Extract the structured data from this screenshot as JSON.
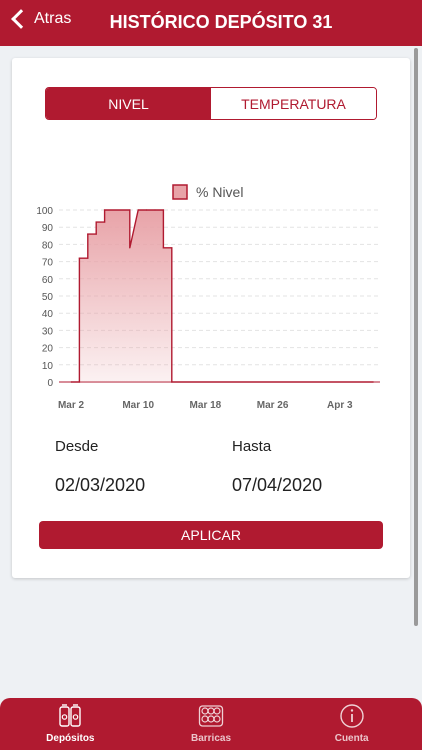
{
  "header": {
    "back_label": "Atras",
    "title": "HISTÓRICO DEPÓSITO 31"
  },
  "segmented": {
    "tabs": [
      {
        "label": "NIVEL",
        "active": true
      },
      {
        "label": "TEMPERATURA",
        "active": false
      }
    ]
  },
  "chart_data": {
    "type": "area",
    "legend": "% Nivel",
    "ylim": [
      0,
      100
    ],
    "yticks": [
      "0",
      "10",
      "20",
      "30",
      "40",
      "50",
      "60",
      "70",
      "80",
      "90",
      "100"
    ],
    "xticks": [
      "Mar 2",
      "Mar 10",
      "Mar 18",
      "Mar 26",
      "Apr 3"
    ],
    "series": [
      {
        "name": "% Nivel",
        "x": [
          "2020-03-02",
          "2020-03-03",
          "2020-03-03",
          "2020-03-04",
          "2020-03-04",
          "2020-03-05",
          "2020-03-05",
          "2020-03-06",
          "2020-03-06",
          "2020-03-09",
          "2020-03-09",
          "2020-03-10",
          "2020-03-11",
          "2020-03-11",
          "2020-03-12",
          "2020-03-13",
          "2020-03-13",
          "2020-03-14",
          "2020-03-14",
          "2020-04-07"
        ],
        "values": [
          0,
          0,
          72,
          72,
          86,
          86,
          93,
          93,
          100,
          100,
          78,
          100,
          100,
          100,
          100,
          100,
          78,
          78,
          0,
          0
        ]
      }
    ],
    "color": "#b01a30",
    "fill": "#e8a3a8",
    "grid": true
  },
  "range": {
    "from_label": "Desde",
    "from_value": "02/03/2020",
    "to_label": "Hasta",
    "to_value": "07/04/2020"
  },
  "apply_label": "APLICAR",
  "tabbar": {
    "items": [
      {
        "label": "Depósitos",
        "icon": "tanks-icon",
        "active": true
      },
      {
        "label": "Barricas",
        "icon": "barrels-icon",
        "active": false
      },
      {
        "label": "Cuenta",
        "icon": "info-icon",
        "active": false
      }
    ]
  }
}
